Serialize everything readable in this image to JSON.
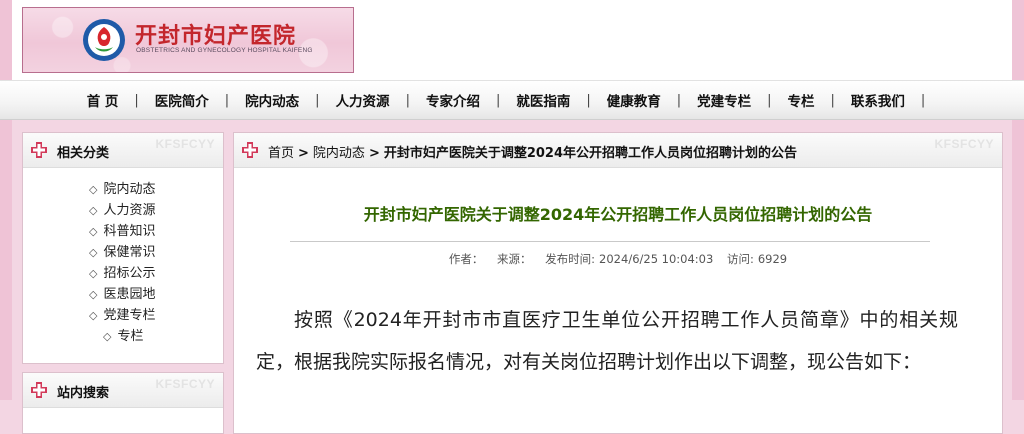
{
  "header": {
    "logo_title": "开封市妇产医院",
    "logo_subtitle": "OBSTETRICS AND GYNECOLOGY HOSPITAL KAIFENG"
  },
  "nav": {
    "items": [
      "首 页",
      "医院简介",
      "院内动态",
      "人力资源",
      "专家介绍",
      "就医指南",
      "健康教育",
      "党建专栏",
      "专栏",
      "联系我们"
    ],
    "separator": "|"
  },
  "sidebar": {
    "category_title": "相关分类",
    "watermark": "KFSFCYY",
    "bullet": "◇",
    "categories": [
      "院内动态",
      "人力资源",
      "科普知识",
      "保健常识",
      "招标公示",
      "医患园地",
      "党建专栏",
      "专栏"
    ],
    "search_title": "站内搜索"
  },
  "breadcrumb": {
    "home": "首页",
    "section": "院内动态",
    "current": "开封市妇产医院关于调整2024年公开招聘工作人员岗位招聘计划的公告",
    "separator": ">"
  },
  "article": {
    "title": "开封市妇产医院关于调整2024年公开招聘工作人员岗位招聘计划的公告",
    "author_label": "作者：",
    "source_label": "来源：",
    "date_label": "发布时间:",
    "date_value": "2024/6/25 10:04:03",
    "views_label": "访问:",
    "views_value": "6929",
    "body": "按照《2024年开封市市直医疗卫生单位公开招聘工作人员简章》中的相关规定，根据我院实际报名情况，对有关岗位招聘计划作出以下调整，现公告如下："
  },
  "colors": {
    "brand_red": "#c3262c",
    "title_green": "#336600",
    "page_pink": "#f3d6e3"
  }
}
